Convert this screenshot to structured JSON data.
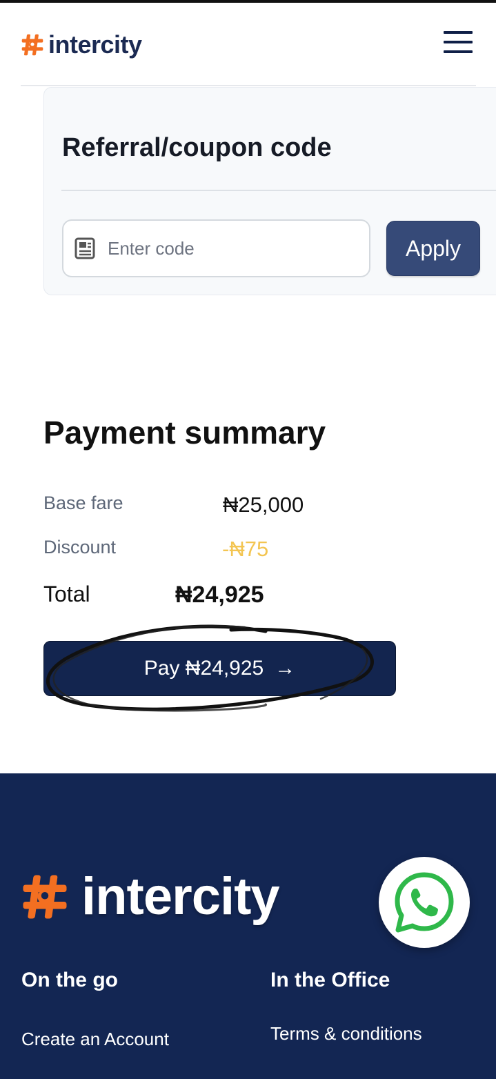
{
  "header": {
    "brand": "intercity",
    "menu_icon": "hamburger-menu-icon"
  },
  "coupon": {
    "title": "Referral/coupon code",
    "input_placeholder": "Enter code",
    "input_value": "",
    "input_icon": "receipt-icon",
    "apply_label": "Apply"
  },
  "summary": {
    "title": "Payment summary",
    "base_fare_label": "Base fare",
    "base_fare_value": "₦25,000",
    "discount_label": "Discount",
    "discount_value": "-₦75",
    "total_label": "Total",
    "total_value": "₦24,925",
    "pay_label": "Pay ₦24,925",
    "pay_arrow": "→"
  },
  "footer": {
    "brand": "intercity",
    "whatsapp_icon": "whatsapp-icon",
    "col1_title": "On the go",
    "col1_links": [
      "Create an Account"
    ],
    "col2_title": "In the Office",
    "col2_links": [
      "Terms & conditions"
    ]
  },
  "colors": {
    "brand_navy": "#132653",
    "brand_orange": "#f36f21",
    "apply_button": "#364a78",
    "discount": "#f3c552",
    "whatsapp_green": "#2fb84a"
  }
}
